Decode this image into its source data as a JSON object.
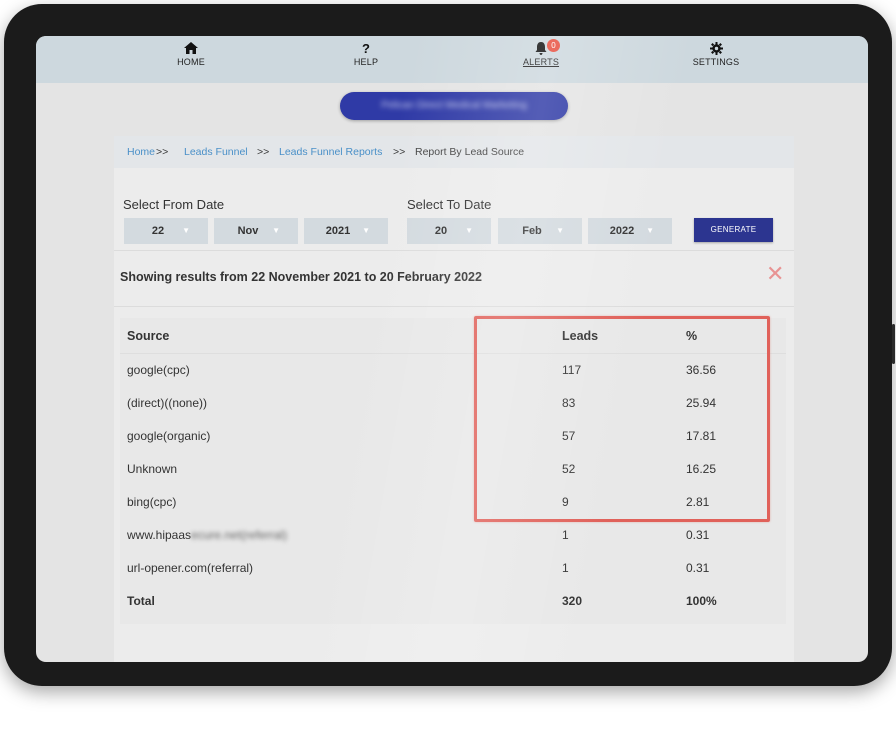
{
  "nav": {
    "home": "HOME",
    "help": "HELP",
    "alerts": "ALERTS",
    "alerts_badge": "0",
    "settings": "SETTINGS"
  },
  "company_pill": "Pelican Direct Medical Marketing",
  "breadcrumb": {
    "home": "Home",
    "sep": ">>",
    "leads_funnel": "Leads Funnel",
    "leads_funnel_reports": "Leads Funnel Reports",
    "current": "Report By Lead Source"
  },
  "from_date": {
    "label": "Select From Date",
    "day": "22",
    "month": "Nov",
    "year": "2021"
  },
  "to_date": {
    "label": "Select To Date",
    "day": "20",
    "month": "Feb",
    "year": "2022"
  },
  "generate_label": "GENERATE",
  "results_text": "Showing results from 22 November 2021 to 20 February 2022",
  "table": {
    "headers": {
      "source": "Source",
      "leads": "Leads",
      "percent": "%"
    },
    "rows": [
      {
        "source": "google(cpc)",
        "leads": "117",
        "percent": "36.56"
      },
      {
        "source": "(direct)((none))",
        "leads": "83",
        "percent": "25.94"
      },
      {
        "source": "google(organic)",
        "leads": "57",
        "percent": "17.81"
      },
      {
        "source": "Unknown",
        "leads": "52",
        "percent": "16.25"
      },
      {
        "source": "bing(cpc)",
        "leads": "9",
        "percent": "2.81"
      },
      {
        "source": "www.hipaas",
        "source_blurred": "ecure.net(referral)",
        "leads": "1",
        "percent": "0.31"
      },
      {
        "source": "url-opener.com(referral)",
        "leads": "1",
        "percent": "0.31"
      }
    ],
    "total": {
      "source": "Total",
      "leads": "320",
      "percent": "100%"
    }
  },
  "colors": {
    "nav_bg": "#cdd8de",
    "pill_bg": "#2f3aa6",
    "link": "#4a90c8",
    "generate_bg": "#2c3590",
    "highlight": "#e0615a",
    "close": "#e89393"
  }
}
